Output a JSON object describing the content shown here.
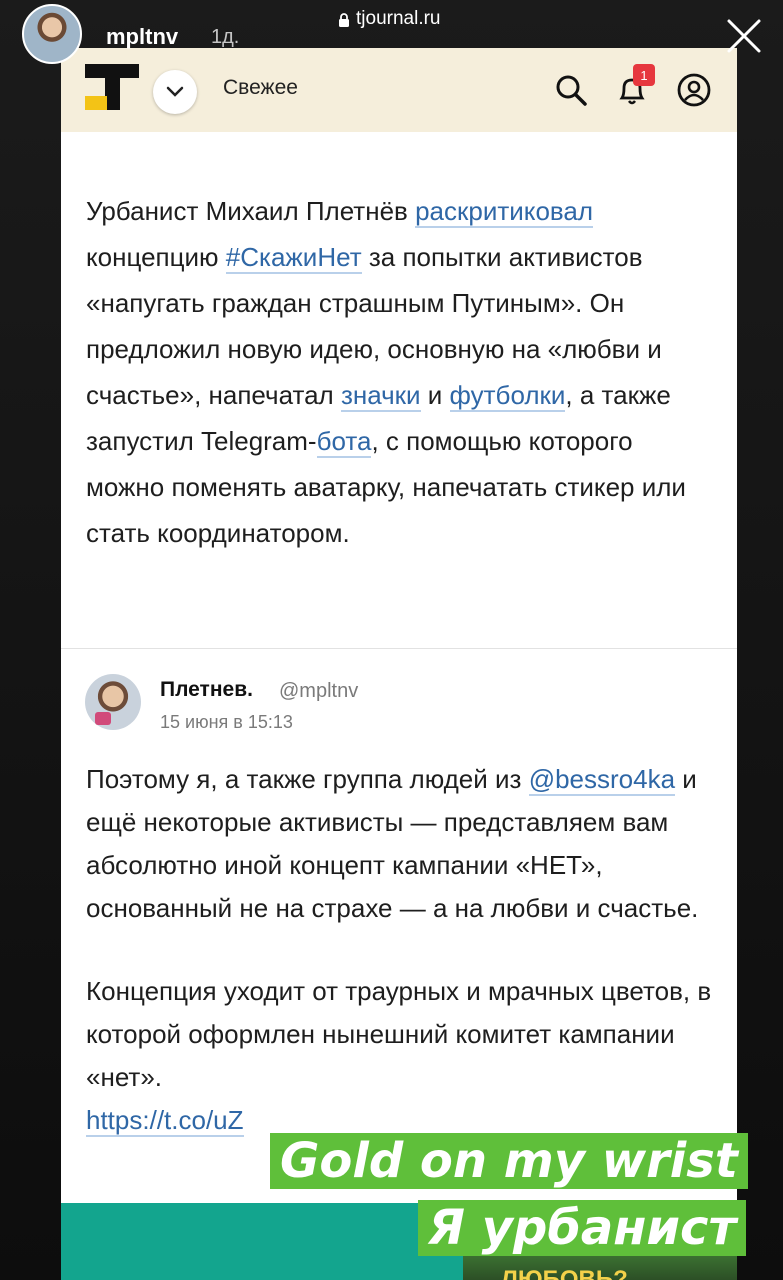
{
  "story": {
    "username": "mpltnv",
    "time": "1д.",
    "url": "tjournal.ru"
  },
  "site": {
    "feed_label": "Свежее",
    "notification_count": "1"
  },
  "article": {
    "p1_a": "Урбанист Михаил Плетнёв ",
    "link1": "раскритиковал",
    "p1_b": " концепцию ",
    "link2": "#СкажиНет",
    "p1_c": " за попытки активистов «напугать граждан страшным Путиным». Он предложил новую идею, основную на «любви и счастье», напечатал ",
    "link3": "значки",
    "p1_d": " и ",
    "link4": "футболки",
    "p1_e": ", а также запустил Telegram-",
    "link5": "бота",
    "p1_f": ", с помощью которого можно поменять аватарку, напечатать стикер или стать координатором."
  },
  "tweet": {
    "name": "Плетнев.",
    "handle": "@mpltnv",
    "date": "15 июня в 15:13",
    "p1_a": "Поэтому я, а также группа людей из ",
    "mention": "@bessro4ka",
    "p1_b": " и ещё некоторые активисты — представляем вам абсолютно иной концепт кампании «НЕТ», основанный не на страхе — а на любви и счастье.",
    "p2": "Концепция уходит от траурных и мрачных цветов, в которой оформлен нынешний комитет кампании «нет».",
    "link": "https://t.co/uZ"
  },
  "banner": {
    "text": "ЛЮБОВЬ?"
  },
  "stickers": {
    "line1": "Gold on my wrist",
    "line2": "Я урбанист"
  },
  "colors": {
    "header_bg": "#f5eedb",
    "link": "#2f67a6",
    "sticker": "#5fbf3a",
    "banner": "#13a58e",
    "badge": "#e6373e"
  }
}
